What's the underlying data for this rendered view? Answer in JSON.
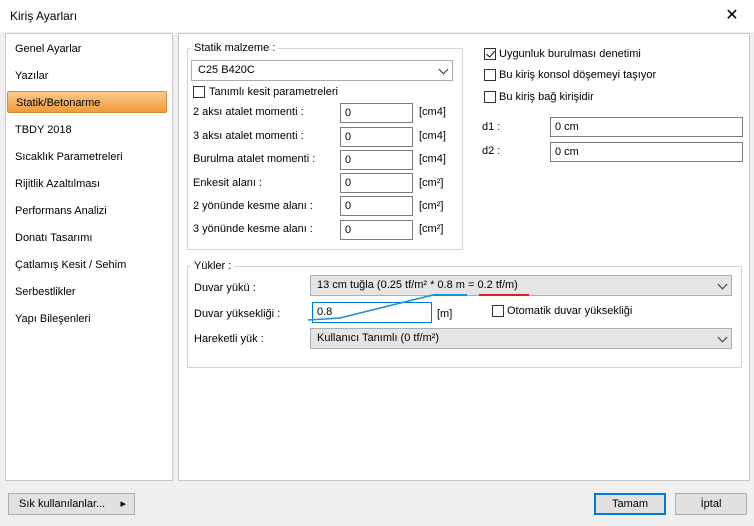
{
  "window": {
    "title": "Kiriş Ayarları",
    "close_glyph": "✕"
  },
  "sidebar": {
    "items": [
      {
        "label": "Genel Ayarlar"
      },
      {
        "label": "Yazılar"
      },
      {
        "label": "Statik/Betonarme"
      },
      {
        "label": "TBDY 2018"
      },
      {
        "label": "Sıcaklık Parametreleri"
      },
      {
        "label": "Rijitlik Azaltılması"
      },
      {
        "label": "Performans Analizi"
      },
      {
        "label": "Donatı Tasarımı"
      },
      {
        "label": "Çatlamış Kesit / Sehim"
      },
      {
        "label": "Serbestlikler"
      },
      {
        "label": "Yapı Bileşenleri"
      }
    ],
    "selected": "Statik/Betonarme"
  },
  "static": {
    "group_title": "Statik malzeme :",
    "material": "C25 B420C",
    "custom_section_label": "Tanımlı kesit parametreleri",
    "rows": [
      {
        "label": "2 aksı atalet momenti :",
        "value": "0",
        "unit": "[cm4]"
      },
      {
        "label": "3 aksı atalet momenti :",
        "value": "0",
        "unit": "[cm4]"
      },
      {
        "label": "Burulma atalet momenti :",
        "value": "0",
        "unit": "[cm4]"
      },
      {
        "label": "Enkesit alanı :",
        "value": "0",
        "unit": "[cm²]"
      },
      {
        "label": "2 yönünde kesme alanı :",
        "value": "0",
        "unit": "[cm²]"
      },
      {
        "label": "3 yönünde kesme alanı :",
        "value": "0",
        "unit": "[cm²]"
      }
    ]
  },
  "right": {
    "checks": [
      {
        "label": "Uygunluk burulması denetimi",
        "checked": true
      },
      {
        "label": "Bu kiriş konsol döşemeyi taşıyor",
        "checked": false
      },
      {
        "label": "Bu kiriş bağ kirişidir",
        "checked": false
      }
    ],
    "d1_label": "d1 :",
    "d1_value": "0 cm",
    "d2_label": "d2 :",
    "d2_value": "0 cm"
  },
  "loads": {
    "group_title": "Yükler :",
    "wall_load_label": "Duvar yükü :",
    "wall_load_value": "13 cm tuğla (0.25 tf/m² * 0.8 m = 0.2 tf/m)",
    "wall_height_label": "Duvar yüksekliği :",
    "wall_height_value": "0.8",
    "wall_height_unit": "[m]",
    "auto_height_label": "Otomatik duvar yüksekliği",
    "live_load_label": "Hareketli yük :",
    "live_load_value": "Kullanıcı Tanımlı (0 tf/m²)"
  },
  "annotations": {
    "blue": "#1a8fd6",
    "red": "#e02020"
  },
  "footer": {
    "frequent_label": "Sık kullanılanlar...",
    "frequent_arrow": "▸",
    "ok_label": "Tamam",
    "cancel_label": "İptal"
  }
}
